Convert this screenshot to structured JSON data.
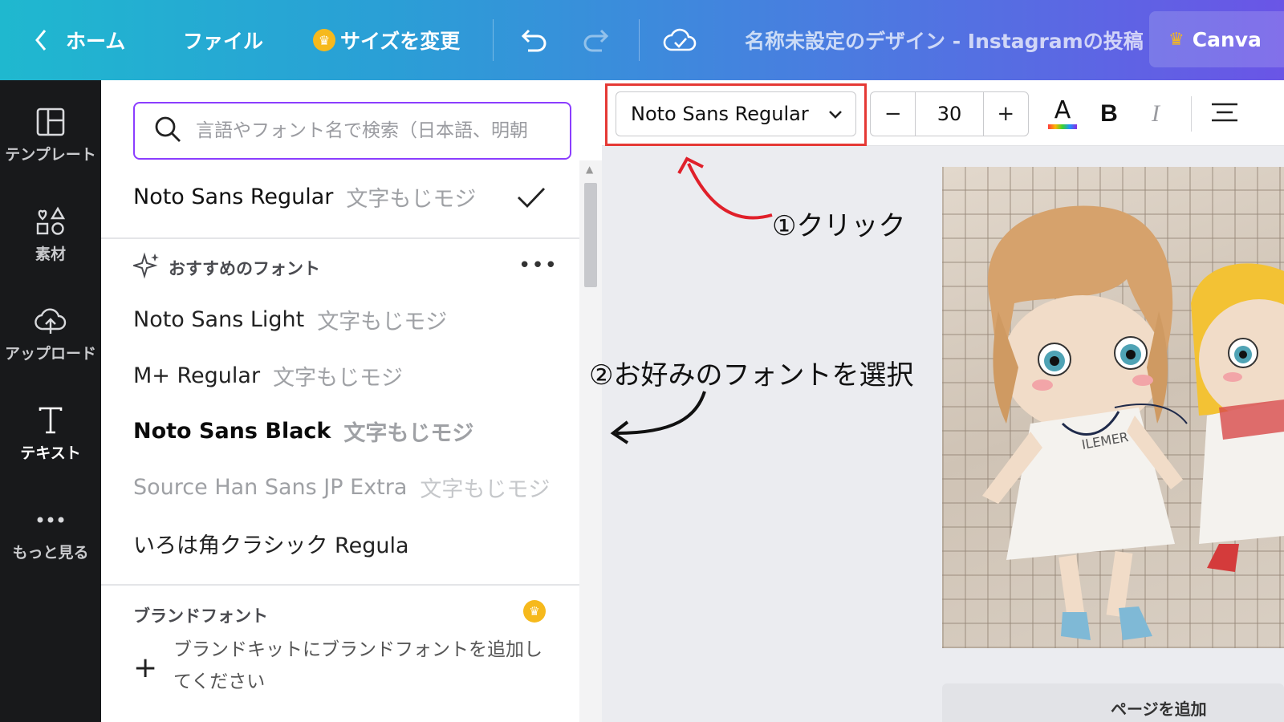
{
  "topbar": {
    "home_label": "ホーム",
    "file_label": "ファイル",
    "resize_label": "サイズを変更",
    "doc_title": "名称未設定のデザイン - Instagramの投稿",
    "canva_pro_label": "Canva",
    "icons": [
      "back-chevron-icon",
      "crown-icon",
      "undo-icon",
      "redo-icon",
      "cloud-check-icon"
    ]
  },
  "rail": {
    "items": [
      {
        "label": "テンプレート",
        "icon": "template-icon"
      },
      {
        "label": "素材",
        "icon": "elements-icon"
      },
      {
        "label": "アップロード",
        "icon": "upload-cloud-icon"
      },
      {
        "label": "テキスト",
        "icon": "text-icon",
        "active": true
      },
      {
        "label": "もっと見る",
        "icon": "more-dots-icon"
      }
    ]
  },
  "font_panel": {
    "search_placeholder": "言語やフォント名で検索（日本語、明朝",
    "selected_font": {
      "name": "Noto Sans Regular",
      "sample": "文字もじモジ"
    },
    "recommended_heading": "おすすめのフォント",
    "recommended": [
      {
        "name": "Noto Sans Light",
        "sample": "文字もじモジ"
      },
      {
        "name": "M+ Regular",
        "sample": "文字もじモジ"
      },
      {
        "name": "Noto Sans Black",
        "sample": "文字もじモジ"
      },
      {
        "name": "Source Han Sans JP Extra",
        "sample": "文字もじモジ"
      },
      {
        "name": "いろは角クラシック Regula",
        "sample": ""
      }
    ],
    "brand_heading": "ブランドフォント",
    "brand_desc": "ブランドキットにブランドフォントを追加してください"
  },
  "toolbar": {
    "font_family": "Noto Sans Regular",
    "font_size": "30",
    "decrease": "−",
    "increase": "+",
    "text_color_glyph": "A",
    "bold_glyph": "B",
    "italic_glyph": "I"
  },
  "annotations": {
    "step1": "①クリック",
    "step2": "②お好みのフォントを選択"
  },
  "canvas": {
    "add_page_label": "ページを追加"
  },
  "colors": {
    "accent_purple": "#8b3dff",
    "highlight_red": "#e53935",
    "crown_gold": "#f6b91c",
    "rail_bg": "#18191b"
  }
}
